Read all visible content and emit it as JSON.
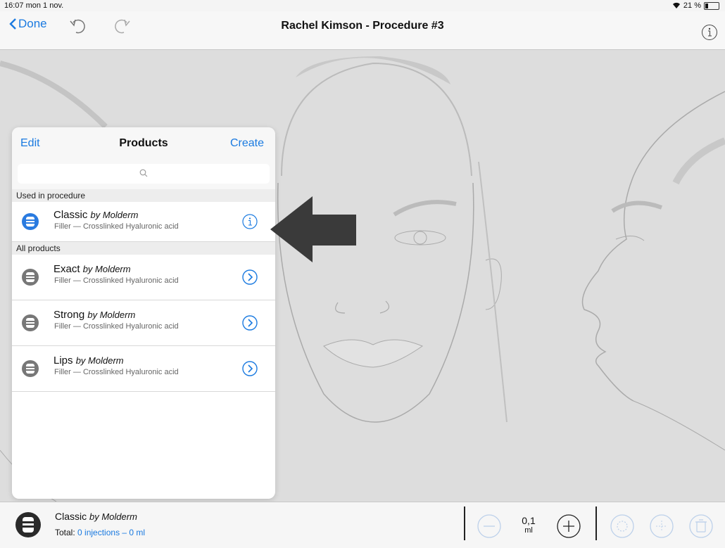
{
  "status": {
    "time_date": "16:07  mon 1 nov.",
    "battery": "21 %"
  },
  "nav": {
    "back_label": "Done",
    "title": "Rachel Kimson - Procedure #3"
  },
  "products": {
    "edit_label": "Edit",
    "title": "Products",
    "create_label": "Create",
    "search_placeholder": "",
    "sections": [
      {
        "header": "Used in procedure"
      },
      {
        "header": "All products"
      }
    ],
    "used": [
      {
        "name": "Classic",
        "brand": "by Molderm",
        "desc": "Filler — Crosslinked Hyaluronic acid",
        "action_icon": "info-icon",
        "active": true
      }
    ],
    "all": [
      {
        "name": "Exact",
        "brand": "by Molderm",
        "desc": "Filler — Crosslinked Hyaluronic acid",
        "action_icon": "chevron-right-icon"
      },
      {
        "name": "Strong",
        "brand": "by Molderm",
        "desc": "Filler — Crosslinked Hyaluronic acid",
        "action_icon": "chevron-right-icon"
      },
      {
        "name": "Lips",
        "brand": "by Molderm",
        "desc": "Filler — Crosslinked Hyaluronic acid",
        "action_icon": "chevron-right-icon"
      }
    ]
  },
  "bottom": {
    "product_name": "Classic",
    "product_brand": "by Molderm",
    "total_label": "Total:",
    "total_value": "0 injections – 0 ml",
    "volume_value": "0,1",
    "volume_unit": "ml"
  },
  "colors": {
    "accent": "#1a7ae0",
    "jar_active": "#2a7be0",
    "jar_inactive": "#777777"
  }
}
